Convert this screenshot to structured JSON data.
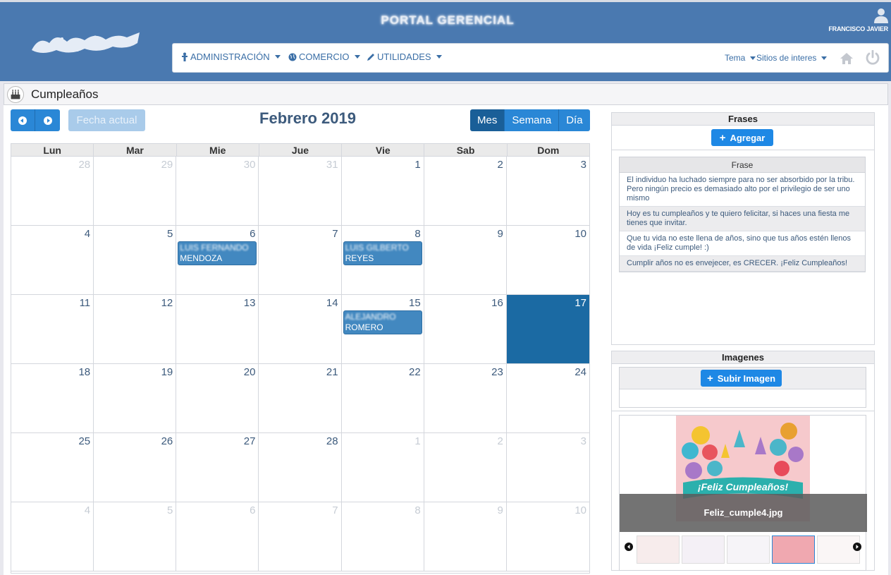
{
  "header": {
    "portal_title": "PORTAL GERENCIAL",
    "user_name": "FRANCISCO JAVIER",
    "menu": [
      {
        "label": "ADMINISTRACIÓN"
      },
      {
        "label": "COMERCIO"
      },
      {
        "label": "UTILIDADES"
      }
    ],
    "right_menu": [
      {
        "label": "Tema"
      },
      {
        "label": "Sitios de interes"
      }
    ]
  },
  "page": {
    "title": "Cumpleaños"
  },
  "calendar": {
    "today_label": "Fecha actual",
    "month_title": "Febrero 2019",
    "views": [
      "Mes",
      "Semana",
      "Día"
    ],
    "active_view": "Mes",
    "weekdays": [
      "Lun",
      "Mar",
      "Mie",
      "Jue",
      "Vie",
      "Sab",
      "Dom"
    ],
    "weeks": [
      [
        "28",
        "29",
        "30",
        "31",
        "1",
        "2",
        "3"
      ],
      [
        "4",
        "5",
        "6",
        "7",
        "8",
        "9",
        "10"
      ],
      [
        "11",
        "12",
        "13",
        "14",
        "15",
        "16",
        "17"
      ],
      [
        "18",
        "19",
        "20",
        "21",
        "22",
        "23",
        "24"
      ],
      [
        "25",
        "26",
        "27",
        "28",
        "1",
        "2",
        "3"
      ],
      [
        "4",
        "5",
        "6",
        "7",
        "8",
        "9",
        "10"
      ]
    ],
    "other_month": [
      [
        0,
        0
      ],
      [
        0,
        1
      ],
      [
        0,
        2
      ],
      [
        0,
        3
      ],
      [
        4,
        4
      ],
      [
        4,
        5
      ],
      [
        4,
        6
      ],
      [
        5,
        0
      ],
      [
        5,
        1
      ],
      [
        5,
        2
      ],
      [
        5,
        3
      ],
      [
        5,
        4
      ],
      [
        5,
        5
      ],
      [
        5,
        6
      ]
    ],
    "today": [
      2,
      6
    ],
    "events": [
      {
        "week": 1,
        "day": 2,
        "line1": "LUIS FERNANDO",
        "line2": "MENDOZA"
      },
      {
        "week": 1,
        "day": 4,
        "line1": "LUIS GILBERTO",
        "line2": "REYES"
      },
      {
        "week": 2,
        "day": 4,
        "line1": "ALEJANDRO",
        "line2": "ROMERO"
      }
    ]
  },
  "frases": {
    "title": "Frases",
    "add_label": "Agregar",
    "column": "Frase",
    "rows": [
      "El individuo ha luchado siempre para no ser absorbido por la tribu. Pero ningún precio es demasiado alto por el privilegio de ser uno mismo",
      "Hoy es tu cumpleaños y te quiero felicitar, si haces una fiesta me tienes que invitar.",
      "Que tu vida no este llena de años, sino que tus años estén llenos de vida ¡Feliz cumple! :)",
      "Cumplir años no es envejecer, es CRECER. ¡Feliz Cumpleaños!"
    ]
  },
  "imagenes": {
    "title": "Imagenes",
    "upload_label": "Subir Imagen",
    "banner_text": "¡Feliz Cumpleaños!",
    "caption": "Feliz_cumple4.jpg",
    "thumbnails": [
      "thumb-1",
      "thumb-2",
      "thumb-3",
      "thumb-4",
      "thumb-5"
    ],
    "active_thumbnail": 3
  },
  "colors": {
    "header": "#4a79b0",
    "primary": "#2a87d6",
    "today": "#1b6aa3",
    "event": "#4288c0"
  }
}
